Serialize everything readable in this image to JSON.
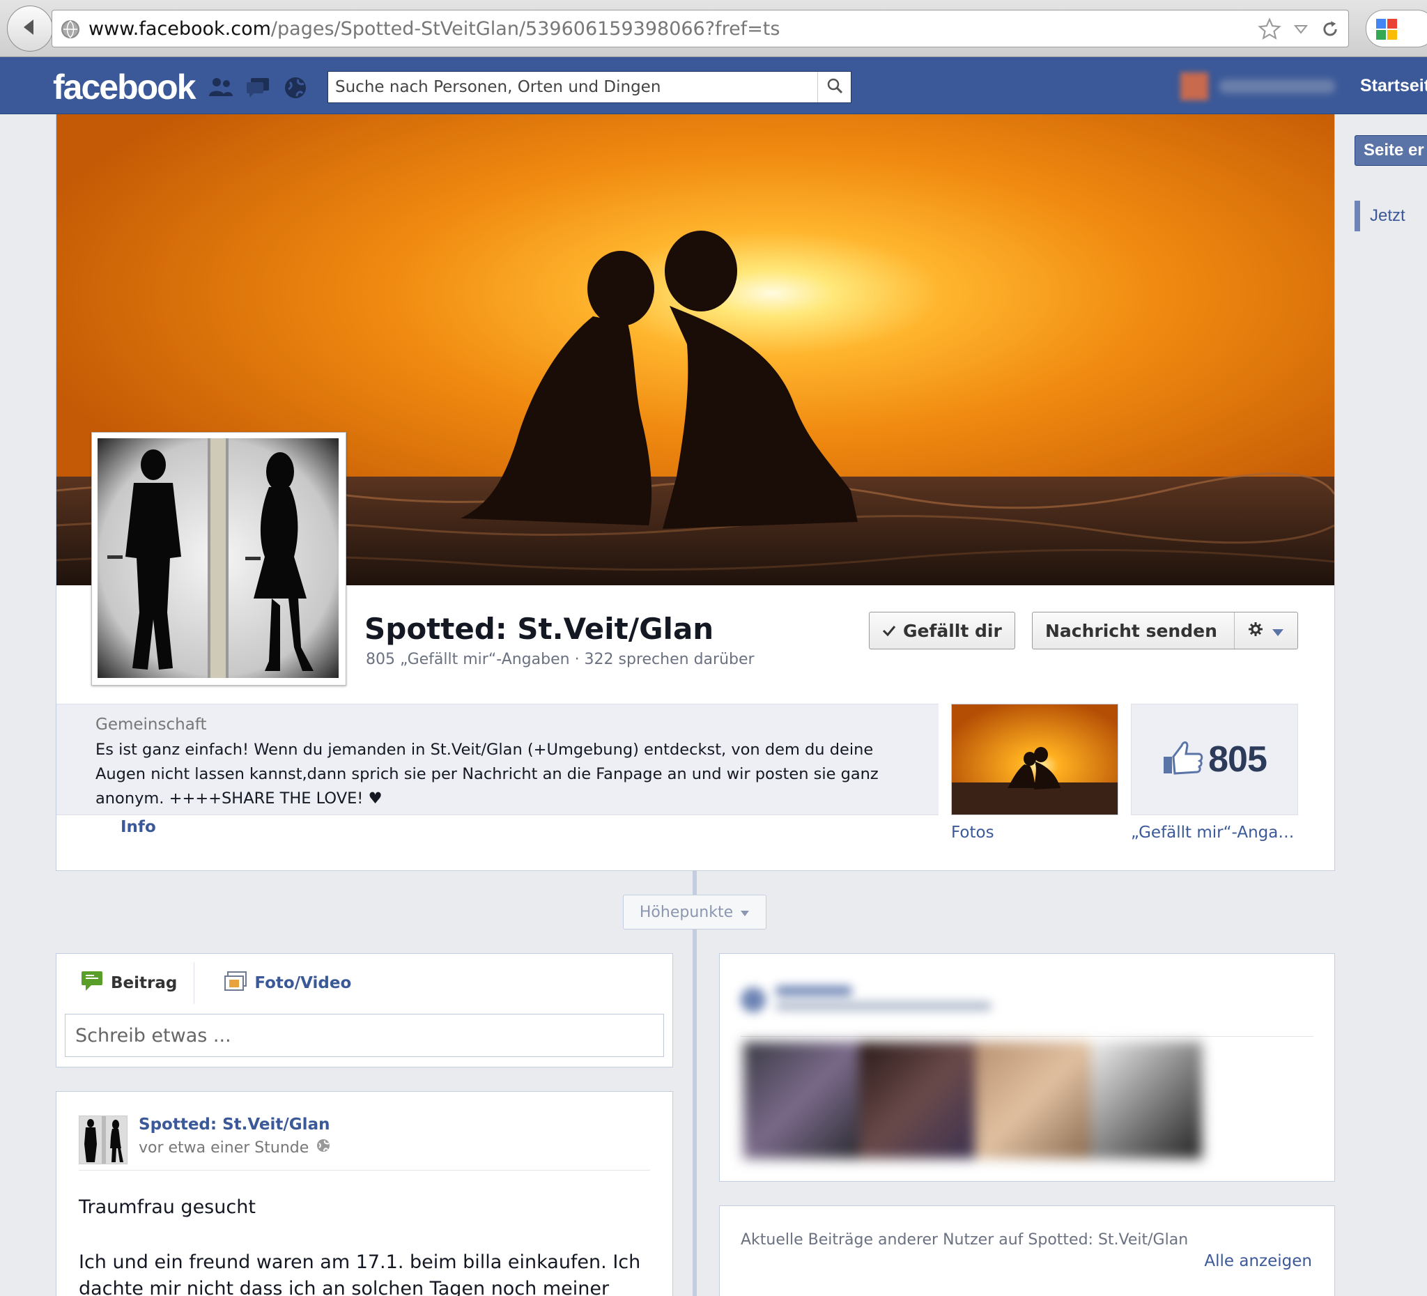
{
  "browser": {
    "url_domain": "www.facebook.com",
    "url_path": "/pages/Spotted-StVeitGlan/539606159398066?fref=ts"
  },
  "fb": {
    "logo": "facebook",
    "search_placeholder": "Suche nach Personen, Orten und Dingen",
    "home_label": "Startseite"
  },
  "right_rail": {
    "create_page_label": "Seite er",
    "now_label": "Jetzt"
  },
  "page": {
    "name": "Spotted: St.Veit/Glan",
    "stats": "805 „Gefällt mir“-Angaben · 322 sprechen darüber",
    "like_button": "Gefällt dir",
    "message_button": "Nachricht senden",
    "category": "Gemeinschaft",
    "about": "Es ist ganz einfach! Wenn du jemanden in St.Veit/Glan (+Umgebung) entdeckst, von dem du deine Augen nicht lassen kannst,dann sprich sie per Nachricht an die Fanpage an und wir posten sie ganz anonym. ++++SHARE THE LOVE! ♥",
    "info_link": "Info",
    "photos_label": "Fotos",
    "likes_count": "805",
    "likes_label": "„Gefällt mir“-Angaben"
  },
  "timeline": {
    "highlights_label": "Höhepunkte"
  },
  "composer": {
    "tab_post": "Beitrag",
    "tab_photo": "Foto/Video",
    "placeholder": "Schreib etwas ..."
  },
  "post": {
    "author": "Spotted: St.Veit/Glan",
    "time": "vor etwa einer Stunde",
    "title": "Traumfrau gesucht",
    "body": "Ich und ein freund waren am 17.1. beim billa einkaufen. Ich dachte mir nicht dass ich an solchen Tagen noch meiner"
  },
  "recent": {
    "title": "Aktuelle Beiträge anderer Nutzer auf Spotted: St.Veit/Glan",
    "show_all": "Alle anzeigen"
  },
  "colors": {
    "fb_blue": "#3b5998",
    "link_blue": "#3b5998",
    "page_bg": "#e9ebee"
  }
}
